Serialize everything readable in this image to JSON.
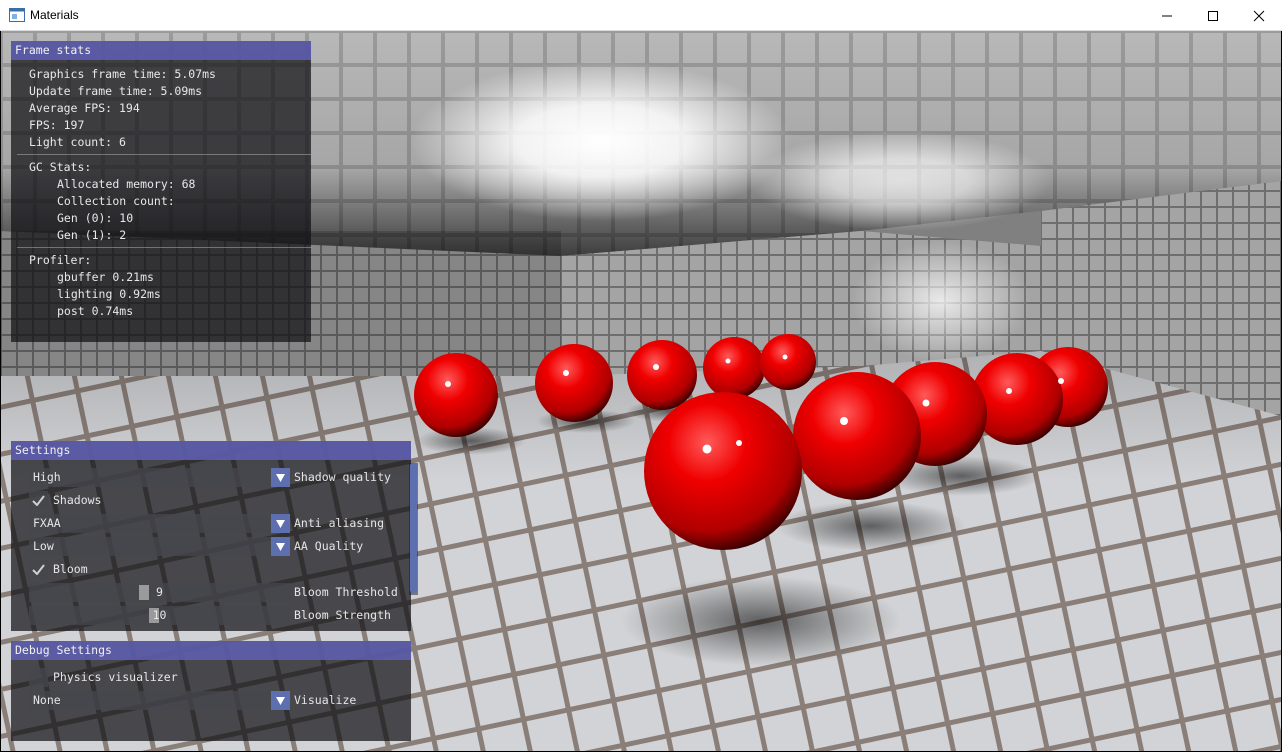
{
  "window": {
    "title": "Materials",
    "icon": "app-window-icon",
    "controls": [
      "minimize-icon",
      "maximize-icon",
      "close-icon"
    ]
  },
  "frame_stats": {
    "title": "Frame stats",
    "graphics_frame_time": "Graphics frame time: 5.07ms",
    "update_frame_time": "Update frame time: 5.09ms",
    "average_fps": "Average FPS: 194",
    "fps": "FPS: 197",
    "light_count": "Light count: 6",
    "gc_stats": "GC Stats:",
    "allocated_memory": "Allocated memory: 68",
    "collection_count": "Collection count:",
    "gen0": "Gen (0): 10",
    "gen1": "Gen (1): 2",
    "profiler": "Profiler:",
    "gbuffer": "gbuffer 0.21ms",
    "lighting": "lighting 0.92ms",
    "post": "post 0.74ms"
  },
  "settings": {
    "title": "Settings",
    "shadow_quality": {
      "value": "High",
      "label": "Shadow quality"
    },
    "shadows": {
      "label": "Shadows",
      "checked": true
    },
    "anti_aliasing": {
      "value": "FXAA",
      "label": "Anti aliasing"
    },
    "aa_quality": {
      "value": "Low",
      "label": "AA Quality"
    },
    "bloom": {
      "label": "Bloom",
      "checked": true
    },
    "bloom_threshold": {
      "value": "9",
      "label": "Bloom Threshold",
      "fraction": 0.44
    },
    "bloom_strength": {
      "value": "10",
      "label": "Bloom Strength",
      "fraction": 0.48
    }
  },
  "debug_settings": {
    "title": "Debug Settings",
    "physics_visualizer": {
      "label": "Physics visualizer",
      "checked": false
    },
    "visualize": {
      "value": "None",
      "label": "Visualize"
    }
  },
  "colors": {
    "panel_header": "#5e5eb2",
    "accent": "#5d6fae",
    "sphere": "#e00000"
  }
}
